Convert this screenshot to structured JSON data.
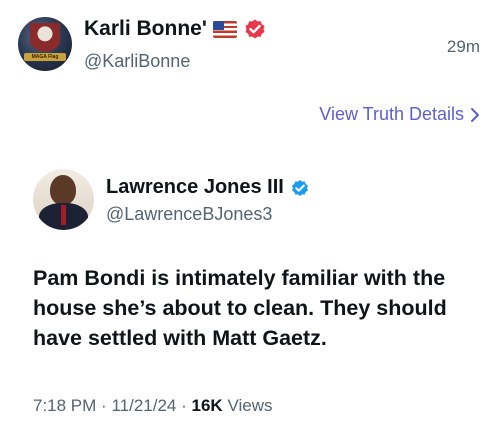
{
  "post": {
    "author_name": "Karli Bonne'",
    "author_handle": "@KarliBonne",
    "timestamp": "29m",
    "view_details_label": "View Truth Details",
    "avatar_banner_text": "MAGA Flag"
  },
  "quoted": {
    "author_name": "Lawrence Jones III",
    "author_handle": "@LawrenceBJones3",
    "text": "Pam Bondi is intimately familiar with the house she’s about to clean. They should have settled with Matt Gaetz.",
    "time": "7:18 PM",
    "date": "11/21/24",
    "views_count": "16K",
    "views_label": "Views",
    "separator": "·"
  },
  "colors": {
    "badge_red": "#e8364a",
    "badge_blue": "#1d9bf0",
    "link": "#5b5fd0",
    "muted": "#536471"
  },
  "icons": [
    "us-flag-icon",
    "verified-badge-red-icon",
    "chevron-right-icon",
    "verified-badge-blue-icon"
  ]
}
